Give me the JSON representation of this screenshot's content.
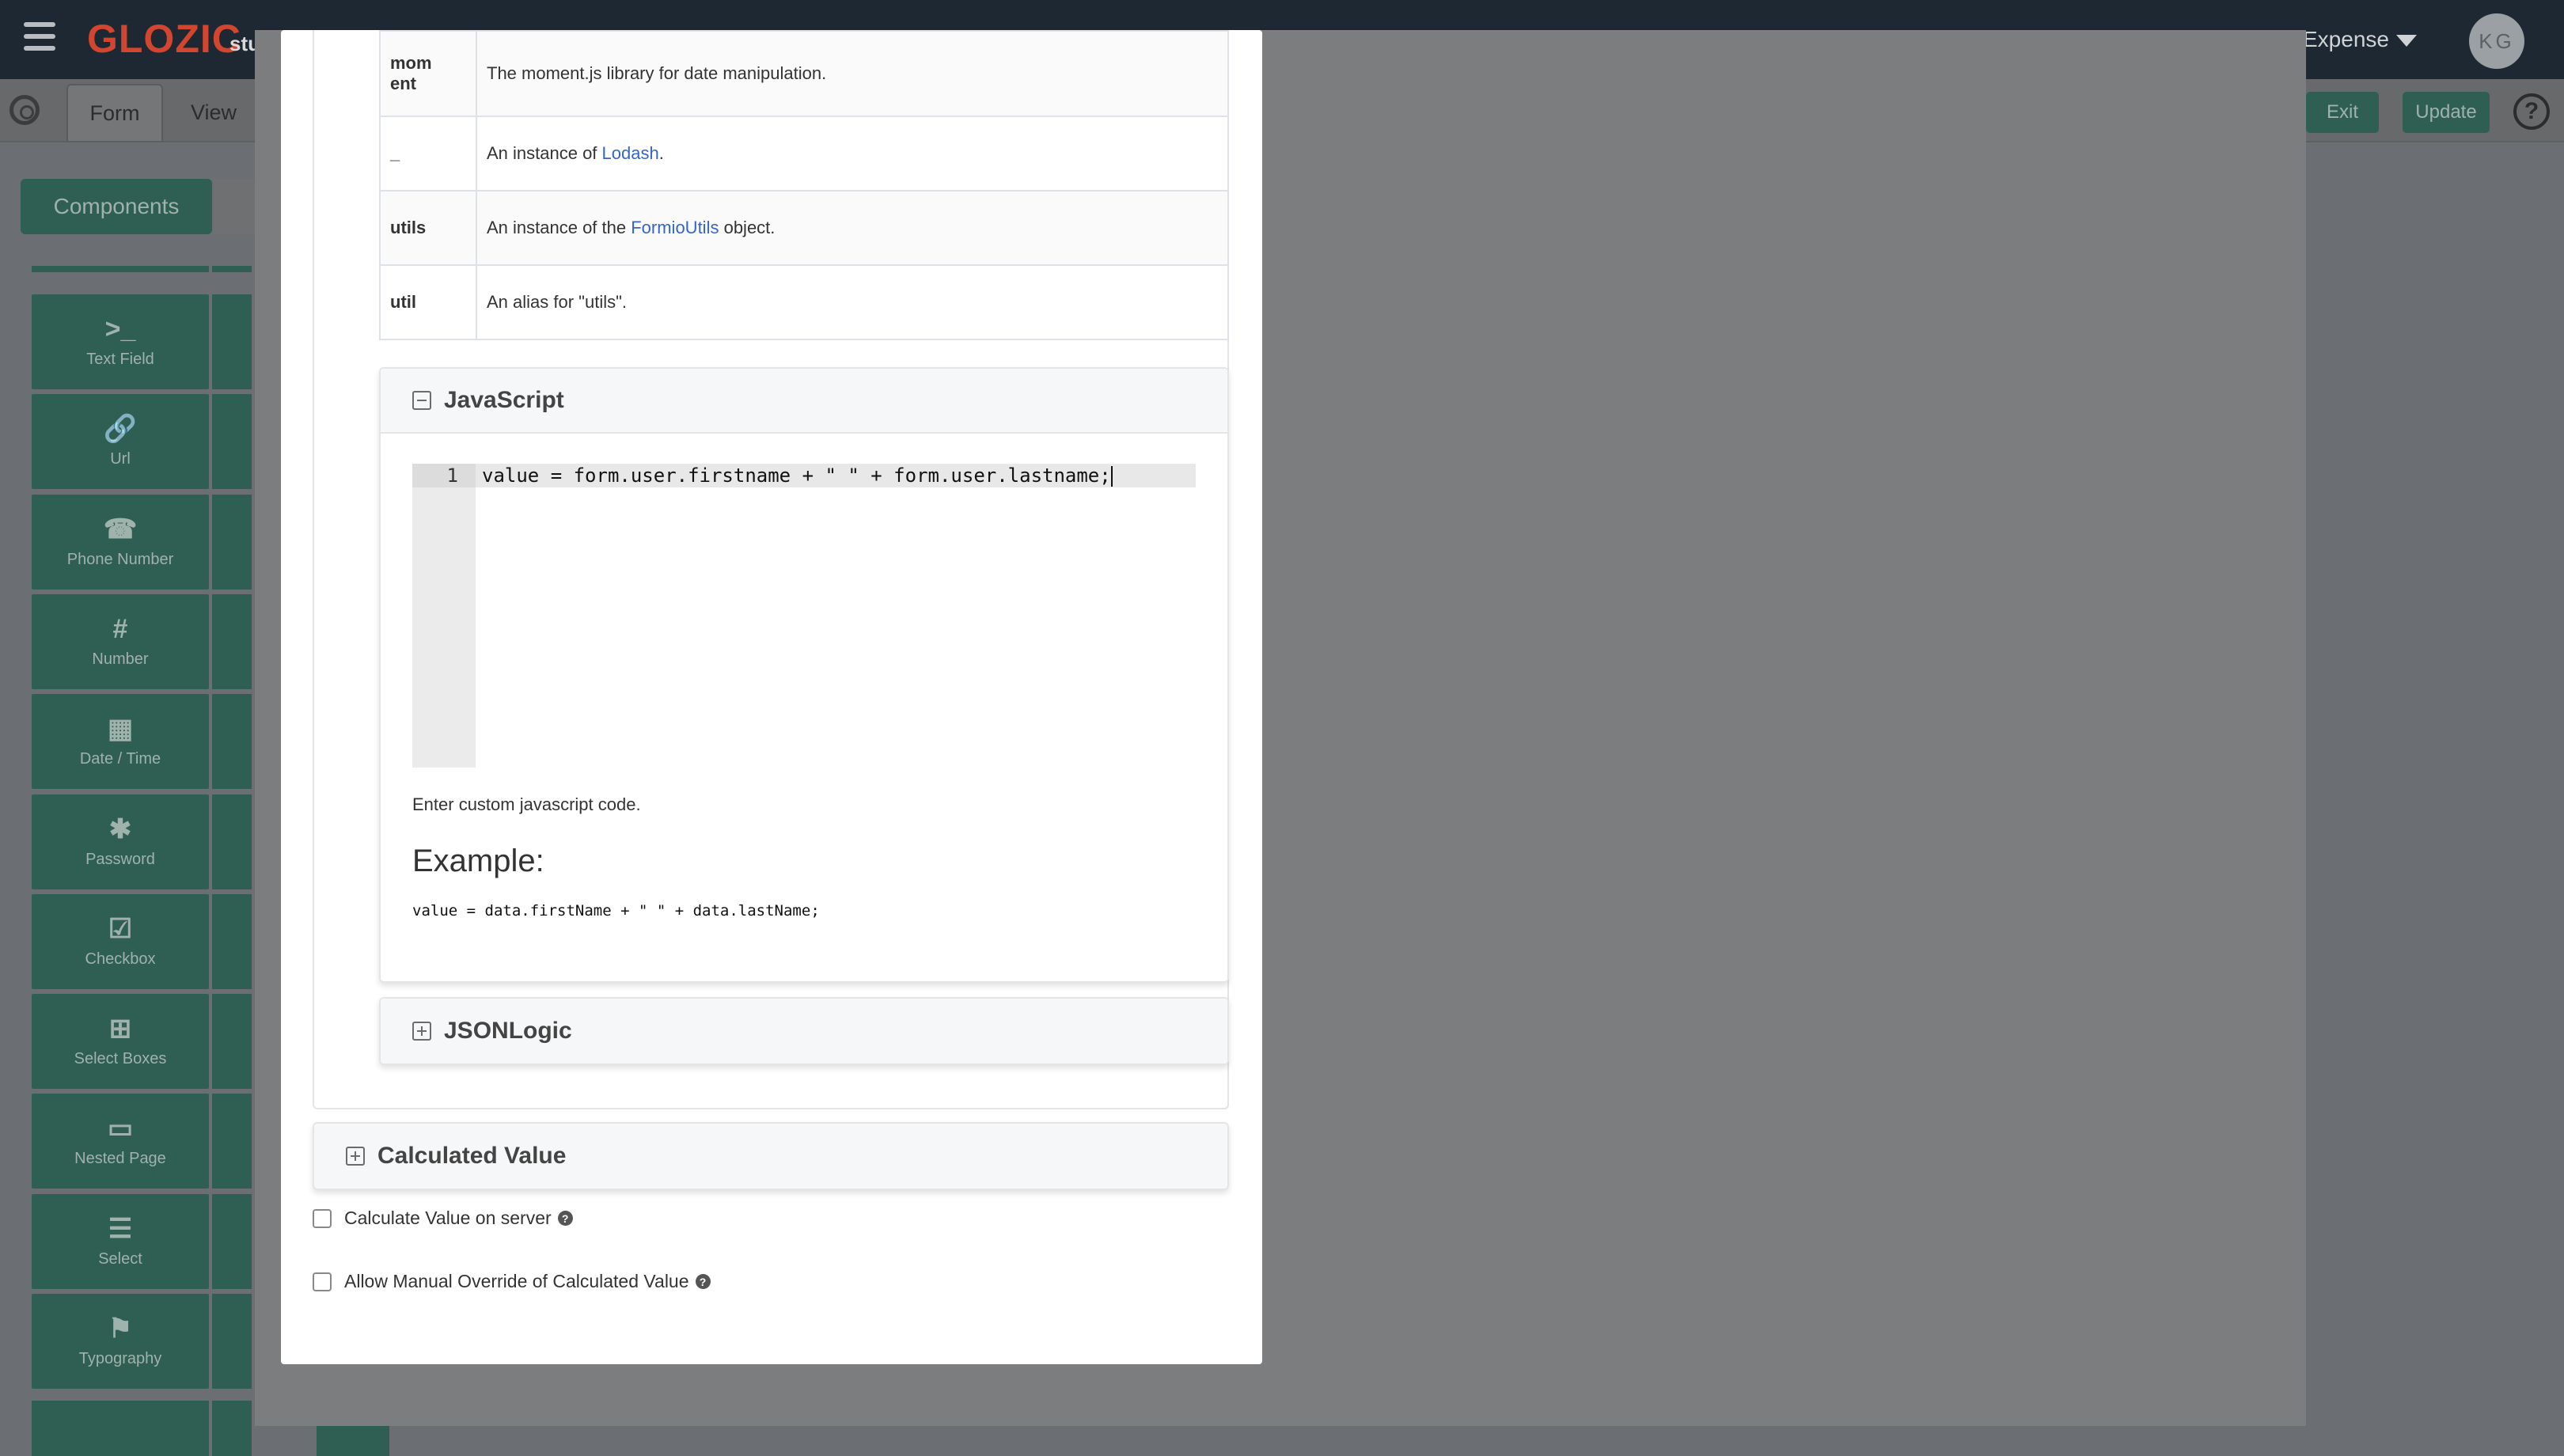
{
  "app": {
    "logo": "GLOZIC",
    "logo_sub": "stu",
    "app_switcher": "Expense",
    "avatar_initials": "KG",
    "tabs": [
      "Form",
      "View"
    ],
    "buttons": {
      "exit": "Exit",
      "update": "Update"
    },
    "components_button": "Components",
    "palette": [
      {
        "label": "Text Field",
        "icon": "terminal-icon",
        "glyph": ">_"
      },
      {
        "label": "Url",
        "icon": "link-icon",
        "glyph": "🔗"
      },
      {
        "label": "Phone Number",
        "icon": "phone-icon",
        "glyph": "☎"
      },
      {
        "label": "Number",
        "icon": "hash-icon",
        "glyph": "#"
      },
      {
        "label": "Date / Time",
        "icon": "calendar-icon",
        "glyph": "▦"
      },
      {
        "label": "Password",
        "icon": "asterisk-icon",
        "glyph": "✱"
      },
      {
        "label": "Checkbox",
        "icon": "checkbox-icon",
        "glyph": "☑"
      },
      {
        "label": "Select Boxes",
        "icon": "plus-square-icon",
        "glyph": "⊞"
      },
      {
        "label": "Nested Page",
        "icon": "card-icon",
        "glyph": "▭"
      },
      {
        "label": "Select",
        "icon": "list-icon",
        "glyph": "☰"
      },
      {
        "label": "Typography",
        "icon": "flag-icon",
        "glyph": "⚑"
      }
    ]
  },
  "variables_table": [
    {
      "key": "mom\nent",
      "text_before": "The moment.js library for date manipulation.",
      "link": "",
      "text_after": ""
    },
    {
      "key": "_",
      "text_before": "An instance of ",
      "link": "Lodash",
      "text_after": "."
    },
    {
      "key": "utils",
      "text_before": "An instance of the ",
      "link": "FormioUtils",
      "text_after": " object."
    },
    {
      "key": "util",
      "text_before": "An alias for \"utils\".",
      "link": "",
      "text_after": ""
    }
  ],
  "javascript_panel": {
    "title": "JavaScript",
    "line_number": "1",
    "code_line": "value = form.user.firstname + \" \" + form.user.lastname;",
    "help_text": "Enter custom javascript code.",
    "example_heading": "Example:",
    "example_code": "value = data.firstName + \" \" + data.lastName;"
  },
  "jsonlogic_panel": {
    "title": "JSONLogic"
  },
  "calculated_value": {
    "title": "Calculated Value",
    "calc_on_server_label": "Calculate Value on server",
    "allow_override_label": "Allow Manual Override of Calculated Value"
  },
  "colors": {
    "topbar": "#1d2833",
    "brand_red": "#d2452f",
    "button_green": "#2f5e52",
    "link_blue": "#3465c8"
  }
}
